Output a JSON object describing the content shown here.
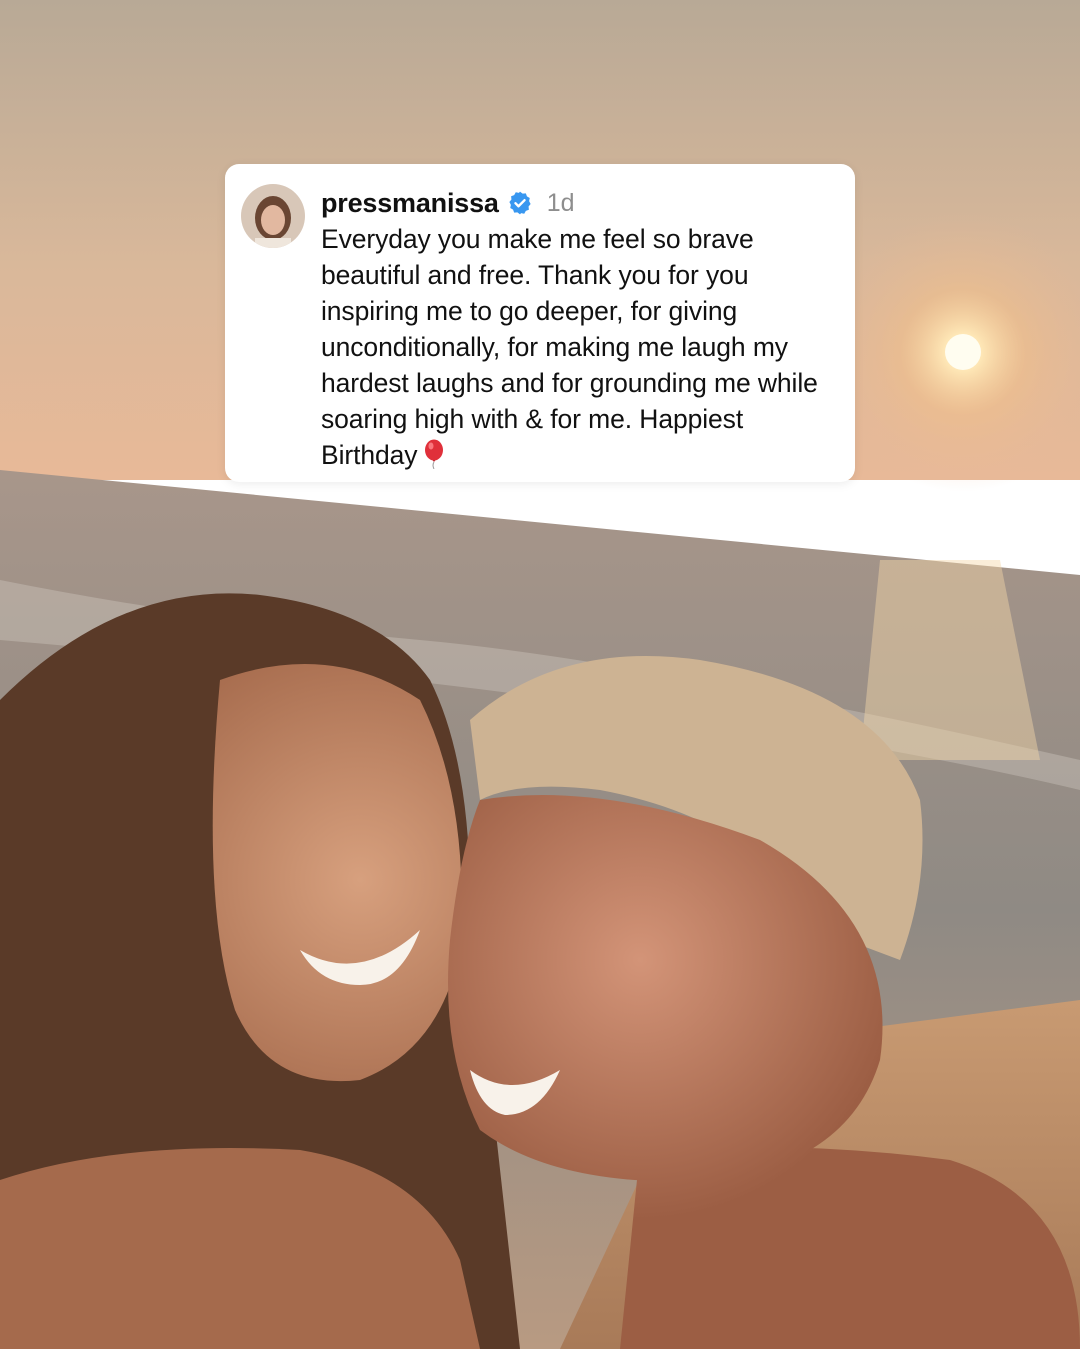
{
  "comment": {
    "username": "pressmanissa",
    "time": "1d",
    "text": "Everyday you make me feel so brave beautiful and free. Thank you for you inspiring me to go deeper, for giving unconditionally, for making me laugh my hardest laughs and for grounding me while soaring high with & for me. Happiest Birthday",
    "emoji": "balloon-emoji"
  },
  "icons": {
    "verified": "verified-badge-icon",
    "verified_color": "#3897f0"
  }
}
